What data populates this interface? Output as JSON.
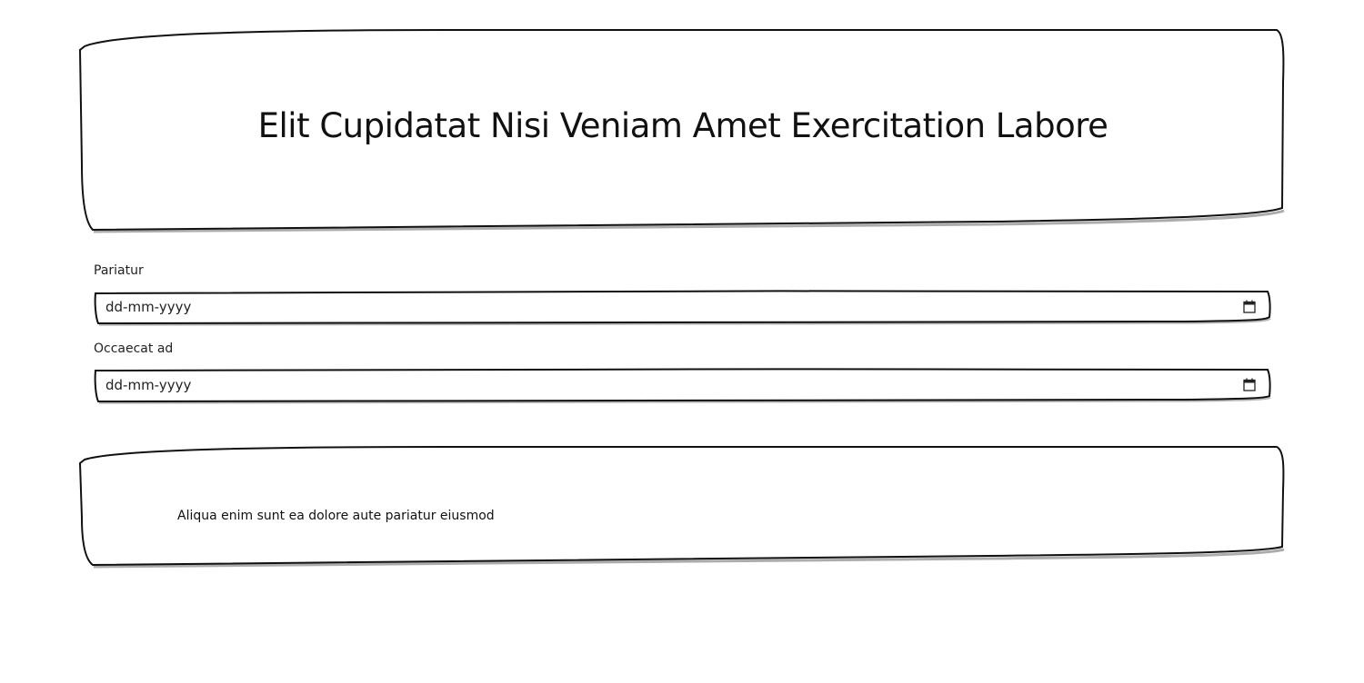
{
  "header": {
    "title": "Elit Cupidatat Nisi Veniam Amet Exercitation Labore"
  },
  "form": {
    "fields": [
      {
        "label": "Pariatur",
        "placeholder": "dd-mm-yyyy",
        "value": "",
        "icon": "calendar-icon"
      },
      {
        "label": "Occaecat ad",
        "placeholder": "dd-mm-yyyy",
        "value": "",
        "icon": "calendar-icon"
      }
    ]
  },
  "info_box": {
    "text": "Aliqua enim sunt ea dolore aute pariatur eiusmod"
  },
  "colors": {
    "background": "#ffffff",
    "stroke": "#111111",
    "text": "#111111"
  }
}
